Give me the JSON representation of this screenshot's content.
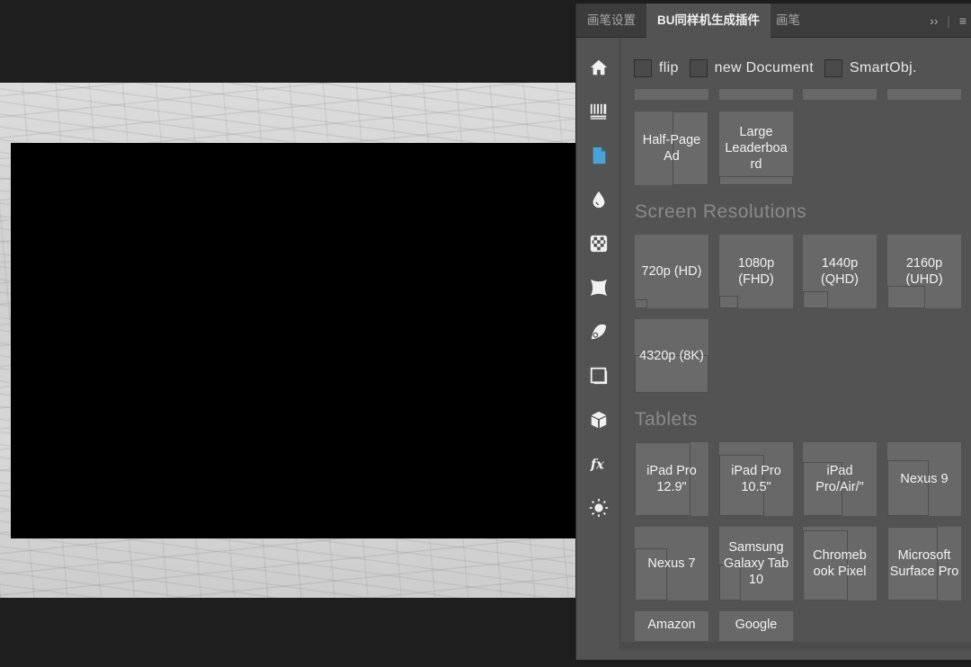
{
  "tabs": [
    {
      "label": "画笔设置",
      "active": false
    },
    {
      "label": "BU同样机生成插件",
      "active": true
    },
    {
      "label": "画笔",
      "active": false
    }
  ],
  "tab_controls": {
    "expand": "››",
    "divider": "|",
    "menu": "≡"
  },
  "side_icons": [
    "home-icon",
    "barcode-icon",
    "document-icon",
    "drop-icon",
    "checker-icon",
    "warp-icon",
    "flag-icon",
    "frame-icon",
    "cube-icon",
    "fx-icon",
    "sun-icon"
  ],
  "options": {
    "flip": "flip",
    "new_document": "new Document",
    "smart_obj": "SmartObj."
  },
  "top_tiles": [
    {
      "label": "Half-Page Ad"
    },
    {
      "label": "Large Leaderboa rd"
    }
  ],
  "sections": [
    {
      "title": "Screen Resolutions",
      "tiles": [
        {
          "label": "720p (HD)"
        },
        {
          "label": "1080p (FHD)"
        },
        {
          "label": "1440p (QHD)"
        },
        {
          "label": "2160p (UHD)"
        },
        {
          "label": "4320p (8K)"
        }
      ]
    },
    {
      "title": "Tablets",
      "tiles": [
        {
          "label": "iPad Pro 12.9\""
        },
        {
          "label": "iPad Pro 10.5\""
        },
        {
          "label": "iPad Pro/Air/\""
        },
        {
          "label": "Nexus 9"
        },
        {
          "label": "Nexus 7"
        },
        {
          "label": "Samsung Galaxy Tab 10"
        },
        {
          "label": "Chromeb ook Pixel"
        },
        {
          "label": "Microsoft Surface Pro"
        },
        {
          "label": "Amazon"
        },
        {
          "label": "Google"
        }
      ]
    }
  ],
  "colors": {
    "panel_bg": "#535353",
    "tile_bg": "#686868",
    "active_icon": "#4aa3d8"
  }
}
